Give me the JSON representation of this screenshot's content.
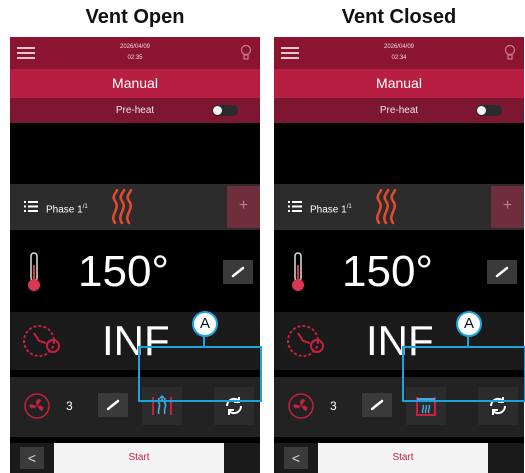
{
  "captions": {
    "left": "Vent Open",
    "right": "Vent Closed"
  },
  "panels": [
    {
      "date": "2026/04/09",
      "time": "02:35",
      "mode": "Manual",
      "preheat_label": "Pre-heat",
      "phase_label": "Phase 1",
      "phase_sup": "/1",
      "plus_label": "+",
      "temperature": "150°",
      "time_value": "INF",
      "fan_value": "3",
      "vent_state": "open",
      "start_label": "Start",
      "back_label": "<"
    },
    {
      "date": "2026/04/09",
      "time": "02:34",
      "mode": "Manual",
      "preheat_label": "Pre-heat",
      "phase_label": "Phase 1",
      "phase_sup": "/1",
      "plus_label": "+",
      "temperature": "150°",
      "time_value": "INF",
      "fan_value": "3",
      "vent_state": "closed",
      "start_label": "Start",
      "back_label": "<"
    }
  ],
  "callouts": {
    "left": "A",
    "right": "A"
  },
  "colors": {
    "status_bar": "#8b1530",
    "mode_bar": "#b61f42",
    "preheat_bar": "#7d1630",
    "accent_red": "#c01f43",
    "callout_blue": "#1aa3dc"
  },
  "icons": [
    "hamburger-icon",
    "bulb-icon",
    "list-icon",
    "heat-icon",
    "thermometer-icon",
    "clock-icon",
    "fan-icon",
    "edit-icon",
    "vent-open-icon",
    "vent-closed-icon",
    "vent-toggle-icon"
  ]
}
